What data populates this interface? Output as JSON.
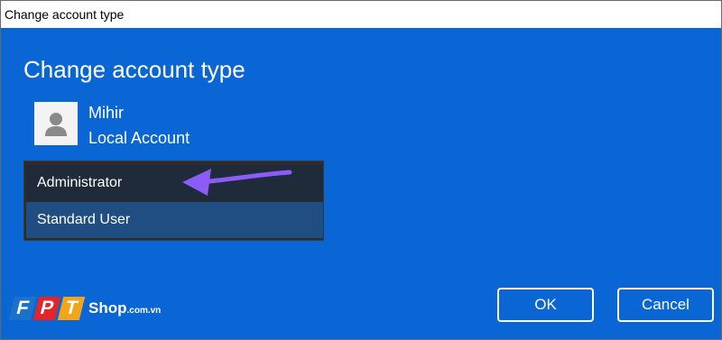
{
  "window": {
    "title": "Change account type"
  },
  "dialog": {
    "heading": "Change account type"
  },
  "user": {
    "name": "Mihir",
    "account_type": "Local Account"
  },
  "account_type_dropdown": {
    "options": [
      "Administrator",
      "Standard User"
    ],
    "selected": "Standard User"
  },
  "buttons": {
    "ok": "OK",
    "cancel": "Cancel"
  },
  "watermark": {
    "letters": [
      "F",
      "P",
      "T"
    ],
    "name": "Shop",
    "suffix": ".com.vn"
  },
  "colors": {
    "background": "#0a66d4",
    "titlebar": "#ffffff",
    "dropdown": "#2c2c2c",
    "selected_option": "#214e82",
    "annotation_arrow": "#8b5cf6"
  }
}
